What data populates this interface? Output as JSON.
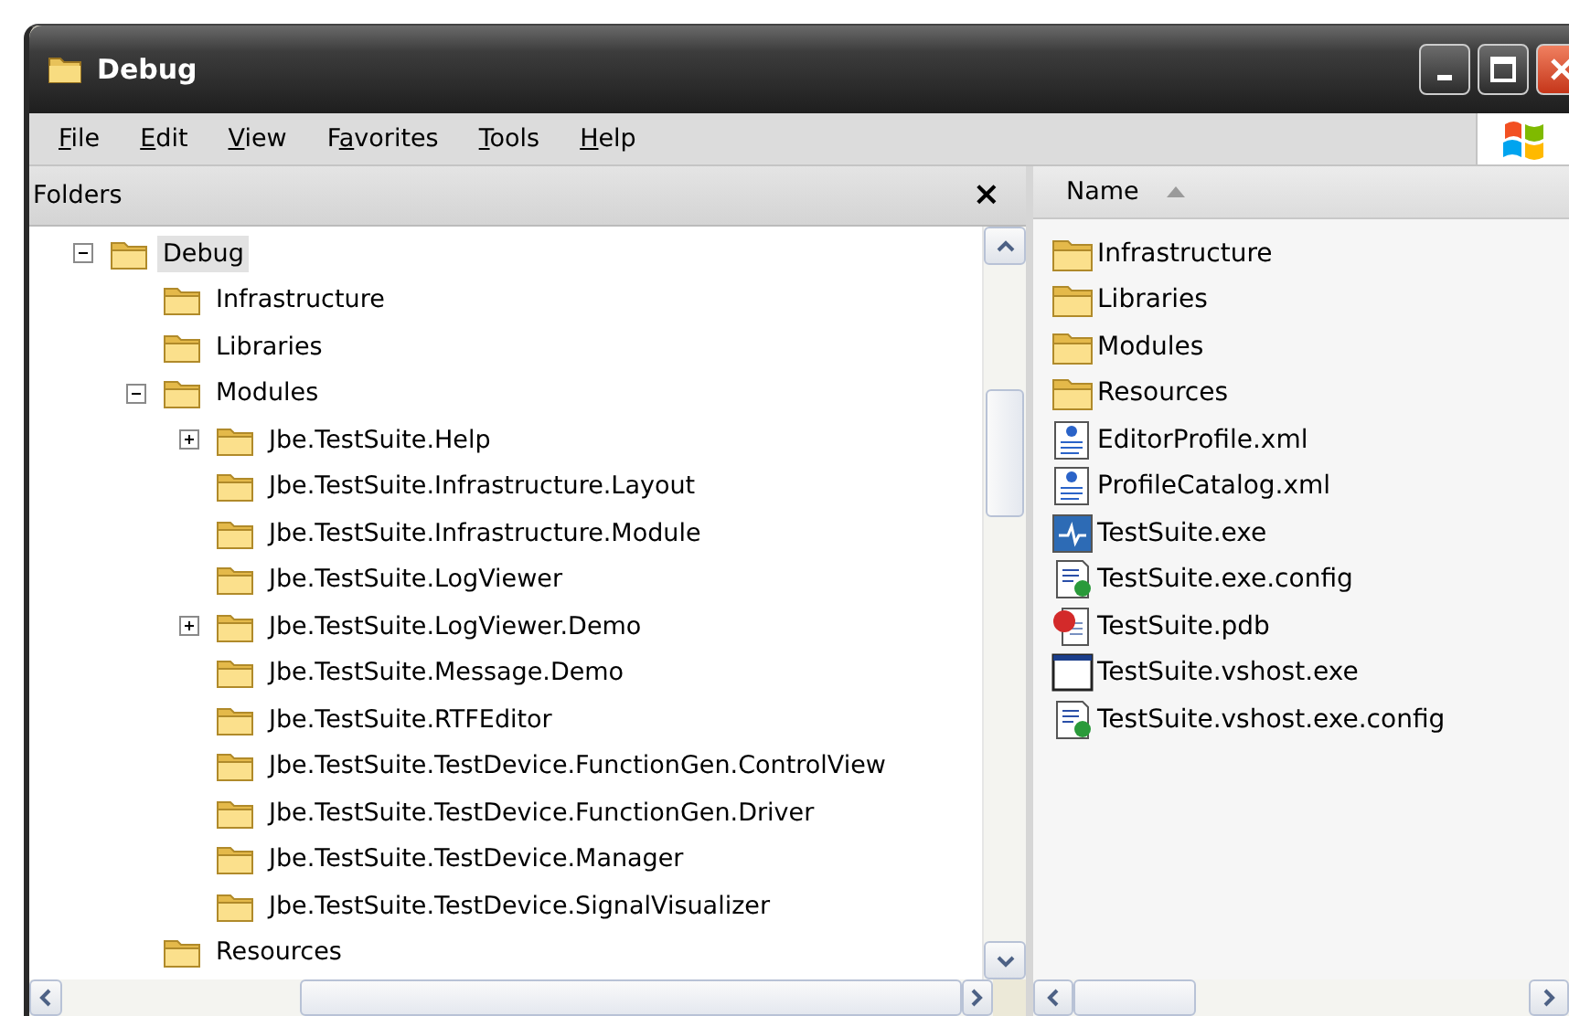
{
  "window": {
    "title": "Debug"
  },
  "menu": [
    {
      "mnemonic": "F",
      "after": "ile"
    },
    {
      "mnemonic": "E",
      "after": "dit"
    },
    {
      "mnemonic": "V",
      "after": "iew"
    },
    {
      "before": "F",
      "mnemonic": "a",
      "after": "vorites"
    },
    {
      "mnemonic": "T",
      "after": "ools"
    },
    {
      "mnemonic": "H",
      "after": "elp"
    }
  ],
  "folders_pane": {
    "title": "Folders",
    "close": "×",
    "tree": [
      {
        "label": "Debug",
        "selected": true,
        "expanded": true,
        "children": [
          {
            "label": "Infrastructure",
            "selected": false
          },
          {
            "label": "Libraries",
            "selected": false
          },
          {
            "label": "Modules",
            "selected": false,
            "expanded": true,
            "children": [
              {
                "label": "Jbe.TestSuite.Help",
                "selected": false,
                "expanded": false
              },
              {
                "label": "Jbe.TestSuite.Infrastructure.Layout",
                "selected": false
              },
              {
                "label": "Jbe.TestSuite.Infrastructure.Module",
                "selected": false
              },
              {
                "label": "Jbe.TestSuite.LogViewer",
                "selected": false
              },
              {
                "label": "Jbe.TestSuite.LogViewer.Demo",
                "selected": false,
                "expanded": false
              },
              {
                "label": "Jbe.TestSuite.Message.Demo",
                "selected": false
              },
              {
                "label": "Jbe.TestSuite.RTFEditor",
                "selected": false
              },
              {
                "label": "Jbe.TestSuite.TestDevice.FunctionGen.ControlView",
                "selected": false
              },
              {
                "label": "Jbe.TestSuite.TestDevice.FunctionGen.Driver",
                "selected": false
              },
              {
                "label": "Jbe.TestSuite.TestDevice.Manager",
                "selected": false
              },
              {
                "label": "Jbe.TestSuite.TestDevice.SignalVisualizer",
                "selected": false
              }
            ]
          },
          {
            "label": "Resources",
            "selected": false
          }
        ]
      }
    ]
  },
  "file_list": {
    "columns": [
      {
        "label": "Name",
        "sorted_ascending": true
      }
    ],
    "rows": [
      {
        "name": "Infrastructure",
        "kind": "folder"
      },
      {
        "name": "Libraries",
        "kind": "folder"
      },
      {
        "name": "Modules",
        "kind": "folder"
      },
      {
        "name": "Resources",
        "kind": "folder"
      },
      {
        "name": "EditorProfile.xml",
        "kind": "xml"
      },
      {
        "name": "ProfileCatalog.xml",
        "kind": "xml"
      },
      {
        "name": "TestSuite.exe",
        "kind": "app"
      },
      {
        "name": "TestSuite.exe.config",
        "kind": "config"
      },
      {
        "name": "TestSuite.pdb",
        "kind": "pdb"
      },
      {
        "name": "TestSuite.vshost.exe",
        "kind": "exe"
      },
      {
        "name": "TestSuite.vshost.exe.config",
        "kind": "config"
      }
    ]
  }
}
